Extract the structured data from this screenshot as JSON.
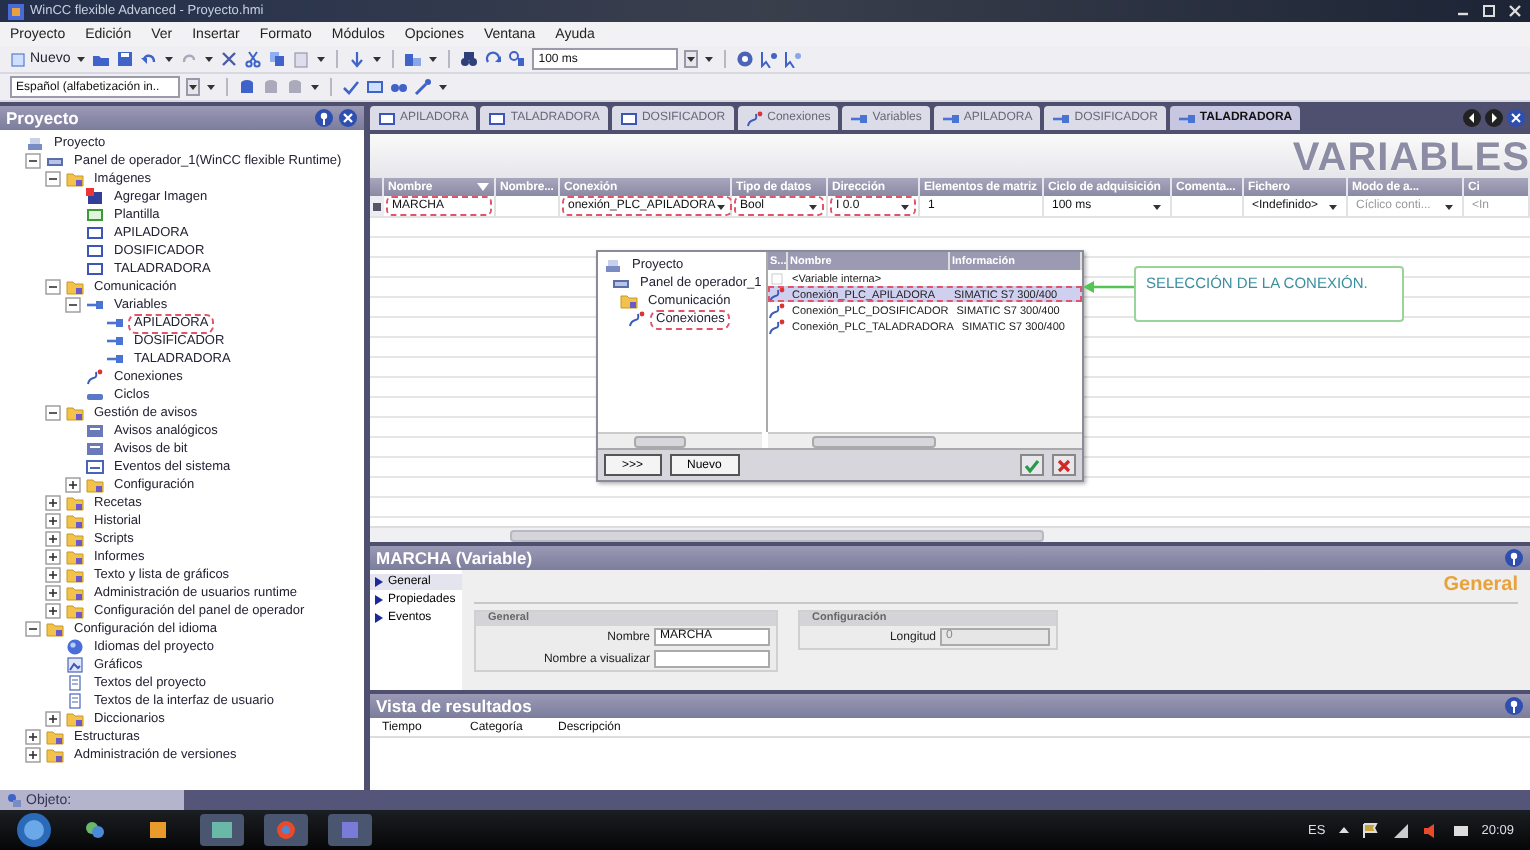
{
  "window": {
    "title": "WinCC flexible Advanced - Proyecto.hmi"
  },
  "menu": [
    "Proyecto",
    "Edición",
    "Ver",
    "Insertar",
    "Formato",
    "Módulos",
    "Opciones",
    "Ventana",
    "Ayuda"
  ],
  "toolbar": {
    "new_label": "Nuevo",
    "zoom": "100 ms",
    "language": "Español (alfabetización in.."
  },
  "project_panel": {
    "title": "Proyecto",
    "tree": [
      {
        "label": "Proyecto",
        "kind": "project",
        "children": [
          {
            "label": "Panel de operador_1(WinCC flexible Runtime)",
            "kind": "device",
            "expanded": true,
            "children": [
              {
                "label": "Imágenes",
                "kind": "folder",
                "expanded": true,
                "children": [
                  {
                    "label": "Agregar Imagen",
                    "kind": "add-screen"
                  },
                  {
                    "label": "Plantilla",
                    "kind": "template"
                  },
                  {
                    "label": "APILADORA",
                    "kind": "screen"
                  },
                  {
                    "label": "DOSIFICADOR",
                    "kind": "screen"
                  },
                  {
                    "label": "TALADRADORA",
                    "kind": "screen"
                  }
                ]
              },
              {
                "label": "Comunicación",
                "kind": "folder",
                "expanded": true,
                "children": [
                  {
                    "label": "Variables",
                    "kind": "tag",
                    "expanded": true,
                    "children": [
                      {
                        "label": "APILADORA",
                        "kind": "tag",
                        "annotated": true
                      },
                      {
                        "label": "DOSIFICADOR",
                        "kind": "tag",
                        "annotated": false
                      },
                      {
                        "label": "TALADRADORA",
                        "kind": "tag",
                        "annotated": false
                      }
                    ]
                  },
                  {
                    "label": "Conexiones",
                    "kind": "connection"
                  },
                  {
                    "label": "Ciclos",
                    "kind": "cycle"
                  }
                ]
              },
              {
                "label": "Gestión de avisos",
                "kind": "folder",
                "expanded": true,
                "children": [
                  {
                    "label": "Avisos analógicos",
                    "kind": "alarm"
                  },
                  {
                    "label": "Avisos de bit",
                    "kind": "alarm"
                  },
                  {
                    "label": "Eventos del sistema",
                    "kind": "event"
                  },
                  {
                    "label": "Configuración",
                    "kind": "folder",
                    "expanded": false
                  }
                ]
              },
              {
                "label": "Recetas",
                "kind": "folder",
                "expanded": false
              },
              {
                "label": "Historial",
                "kind": "folder",
                "expanded": false
              },
              {
                "label": "Scripts",
                "kind": "folder",
                "expanded": false
              },
              {
                "label": "Informes",
                "kind": "folder",
                "expanded": false
              },
              {
                "label": "Texto y lista de gráficos",
                "kind": "folder",
                "expanded": false
              },
              {
                "label": "Administración de usuarios runtime",
                "kind": "folder",
                "expanded": false
              },
              {
                "label": "Configuración del panel de operador",
                "kind": "folder",
                "expanded": false
              }
            ]
          },
          {
            "label": "Configuración del idioma",
            "kind": "folder",
            "expanded": true,
            "children": [
              {
                "label": "Idiomas del proyecto",
                "kind": "globe"
              },
              {
                "label": "Gráficos",
                "kind": "graphic"
              },
              {
                "label": "Textos del proyecto",
                "kind": "text"
              },
              {
                "label": "Textos de la interfaz de usuario",
                "kind": "text"
              },
              {
                "label": "Diccionarios",
                "kind": "folder",
                "expanded": false
              }
            ]
          },
          {
            "label": "Estructuras",
            "kind": "folder",
            "expanded": false
          },
          {
            "label": "Administración de versiones",
            "kind": "folder",
            "expanded": false
          }
        ]
      }
    ]
  },
  "tabs": [
    {
      "label": "APILADORA",
      "kind": "screen",
      "selected": false
    },
    {
      "label": "TALADRADORA",
      "kind": "screen",
      "selected": false
    },
    {
      "label": "DOSIFICADOR",
      "kind": "screen",
      "selected": false
    },
    {
      "label": "Conexiones",
      "kind": "connection",
      "selected": false
    },
    {
      "label": "Variables",
      "kind": "tag",
      "selected": false
    },
    {
      "label": "APILADORA",
      "kind": "tag",
      "selected": false
    },
    {
      "label": "DOSIFICADOR",
      "kind": "tag",
      "selected": false
    },
    {
      "label": "TALADRADORA",
      "kind": "tag",
      "selected": true
    }
  ],
  "editor": {
    "heading": "VARIABLES",
    "columns": [
      "Nombre",
      "Nombre...",
      "Conexión",
      "Tipo de datos",
      "Dirección",
      "Elementos de matriz",
      "Ciclo de adquisición",
      "Comenta...",
      "Fichero",
      "Modo de a...",
      "Ci"
    ],
    "rows": [
      {
        "cells": [
          {
            "text": "MARCHA",
            "annotated": true
          },
          null,
          {
            "text": "onexión_PLC_APILADORA",
            "dropdown": true,
            "annotated": true
          },
          {
            "text": "Bool",
            "dropdown": true,
            "annotated": true
          },
          {
            "text": "I 0.0",
            "dropdown": true,
            "annotated": true
          },
          {
            "text": "1"
          },
          {
            "text": "100 ms",
            "dropdown": true
          },
          null,
          {
            "text": "<Indefinido>",
            "dropdown": true
          },
          {
            "text": "Cíclico conti...",
            "dropdown": true,
            "disabled": true
          },
          {
            "text": "<In",
            "disabled": true
          }
        ]
      }
    ]
  },
  "connection_picker": {
    "tree": [
      {
        "label": "Proyecto",
        "kind": "project",
        "annotated": false
      },
      {
        "label": "Panel de operador_1",
        "kind": "device",
        "annotated": false
      },
      {
        "label": "Comunicación",
        "kind": "folder",
        "annotated": false
      },
      {
        "label": "Conexiones",
        "kind": "connection",
        "annotated": true
      }
    ],
    "columns": [
      "S...",
      "Nombre",
      "Información"
    ],
    "rows": [
      {
        "name": "<Variable interna>",
        "kind": "internal",
        "selected": false,
        "annotated": false
      },
      {
        "name": "Conexión_PLC_APILADORA",
        "info": "SIMATIC S7 300/400",
        "kind": "connection",
        "selected": true,
        "annotated": true
      },
      {
        "name": "Conexión_PLC_DOSIFICADOR",
        "info": "SIMATIC S7 300/400",
        "kind": "connection",
        "selected": false,
        "annotated": false
      },
      {
        "name": "Conexión_PLC_TALADRADORA",
        "info": "SIMATIC S7 300/400",
        "kind": "connection",
        "selected": false,
        "annotated": false
      }
    ],
    "buttons": [
      ">>>",
      "Nuevo"
    ]
  },
  "annotation": "SELECCIÓN DE LA CONEXIÓN.",
  "properties": {
    "title": "MARCHA (Variable)",
    "nav": [
      {
        "label": "General",
        "selected": true
      },
      {
        "label": "Propiedades",
        "selected": false
      },
      {
        "label": "Eventos",
        "selected": false
      }
    ],
    "section_title": "General",
    "groups": [
      {
        "title": "General",
        "fields": [
          {
            "label": "Nombre",
            "value": "MARCHA",
            "disabled": false
          },
          {
            "label": "Nombre a visualizar",
            "disabled": false
          }
        ]
      },
      {
        "title": "Configuración",
        "fields": [
          {
            "label": "Longitud",
            "value": "0",
            "disabled": true
          }
        ]
      }
    ]
  },
  "results": {
    "title": "Vista de resultados",
    "columns": [
      "Tiempo",
      "Categoría",
      "Descripción"
    ]
  },
  "object_tab": "Objeto:",
  "taskbar": {
    "language": "ES",
    "clock": "20:09"
  }
}
